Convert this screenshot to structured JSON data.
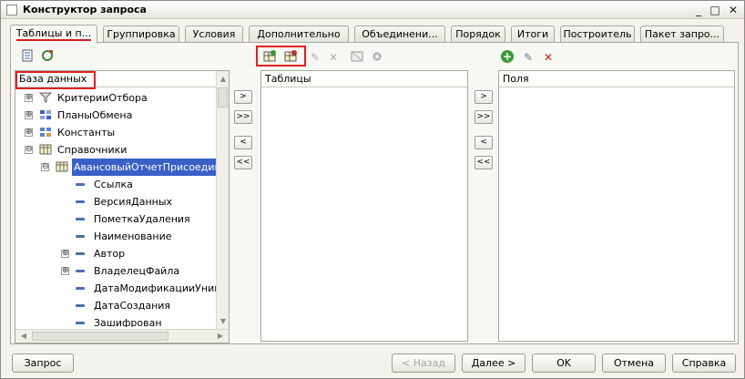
{
  "window": {
    "title": "Конструктор запроса"
  },
  "tabs": [
    {
      "label": "Таблицы и п..."
    },
    {
      "label": "Группировка"
    },
    {
      "label": "Условия"
    },
    {
      "label": "Дополнительно"
    },
    {
      "label": "Объединени..."
    },
    {
      "label": "Порядок"
    },
    {
      "label": "Итоги"
    },
    {
      "label": "Построитель"
    },
    {
      "label": "Пакет запро..."
    }
  ],
  "database_panel": {
    "header": "База данных",
    "items": [
      {
        "label": "КритерииОтбора"
      },
      {
        "label": "ПланыОбмена"
      },
      {
        "label": "Константы"
      },
      {
        "label": "Справочники"
      },
      {
        "label": "АвансовыйОтчетПрисоединен"
      },
      {
        "label": "Ссылка"
      },
      {
        "label": "ВерсияДанных"
      },
      {
        "label": "ПометкаУдаления"
      },
      {
        "label": "Наименование"
      },
      {
        "label": "Автор"
      },
      {
        "label": "ВладелецФайла"
      },
      {
        "label": "ДатаМодификацииУнивер"
      },
      {
        "label": "ДатаСоздания"
      },
      {
        "label": "Зашифрован"
      }
    ]
  },
  "tables_panel": {
    "header": "Таблицы"
  },
  "fields_panel": {
    "header": "Поля"
  },
  "move_buttons": {
    "add": ">",
    "add_all": ">>",
    "remove": "<",
    "remove_all": "<<"
  },
  "icons": {
    "expand": "⊕",
    "collapse": "⊖",
    "add": "+",
    "edit": "✎",
    "delete": "✕",
    "scroll_up": "▲",
    "scroll_down": "▼",
    "scroll_left": "◀",
    "scroll_right": "▶",
    "minimize": "_",
    "maximize": "□",
    "close": "✕"
  },
  "buttons": {
    "query": "Запрос",
    "back": "< Назад",
    "next": "Далее >",
    "ok": "OK",
    "cancel": "Отмена",
    "help": "Справка"
  },
  "colors": {
    "selection": "#3a60c8",
    "highlight": "#e02020"
  }
}
